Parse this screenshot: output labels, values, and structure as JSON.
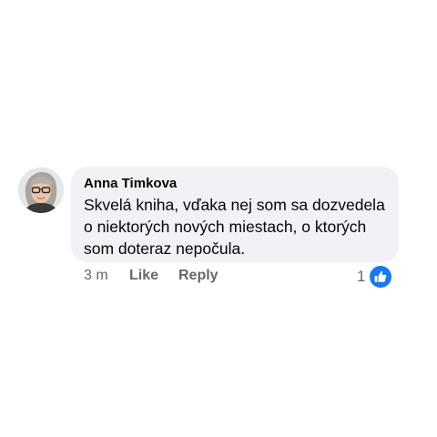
{
  "comment": {
    "author": "Anna Timkova",
    "text": "Skvelá kniha, vďaka nej som sa dozvedela\no niektorých nových miestach, o ktorých\nsom doteraz nepočula.",
    "time": "3 m",
    "like_label": "Like",
    "reply_label": "Reply",
    "reaction_count": "1",
    "reaction_icon": "thumbs-up-icon"
  },
  "colors": {
    "bubble_background": "#f0f2f5",
    "secondary_text": "#65676b",
    "accent": "#1877f2"
  }
}
